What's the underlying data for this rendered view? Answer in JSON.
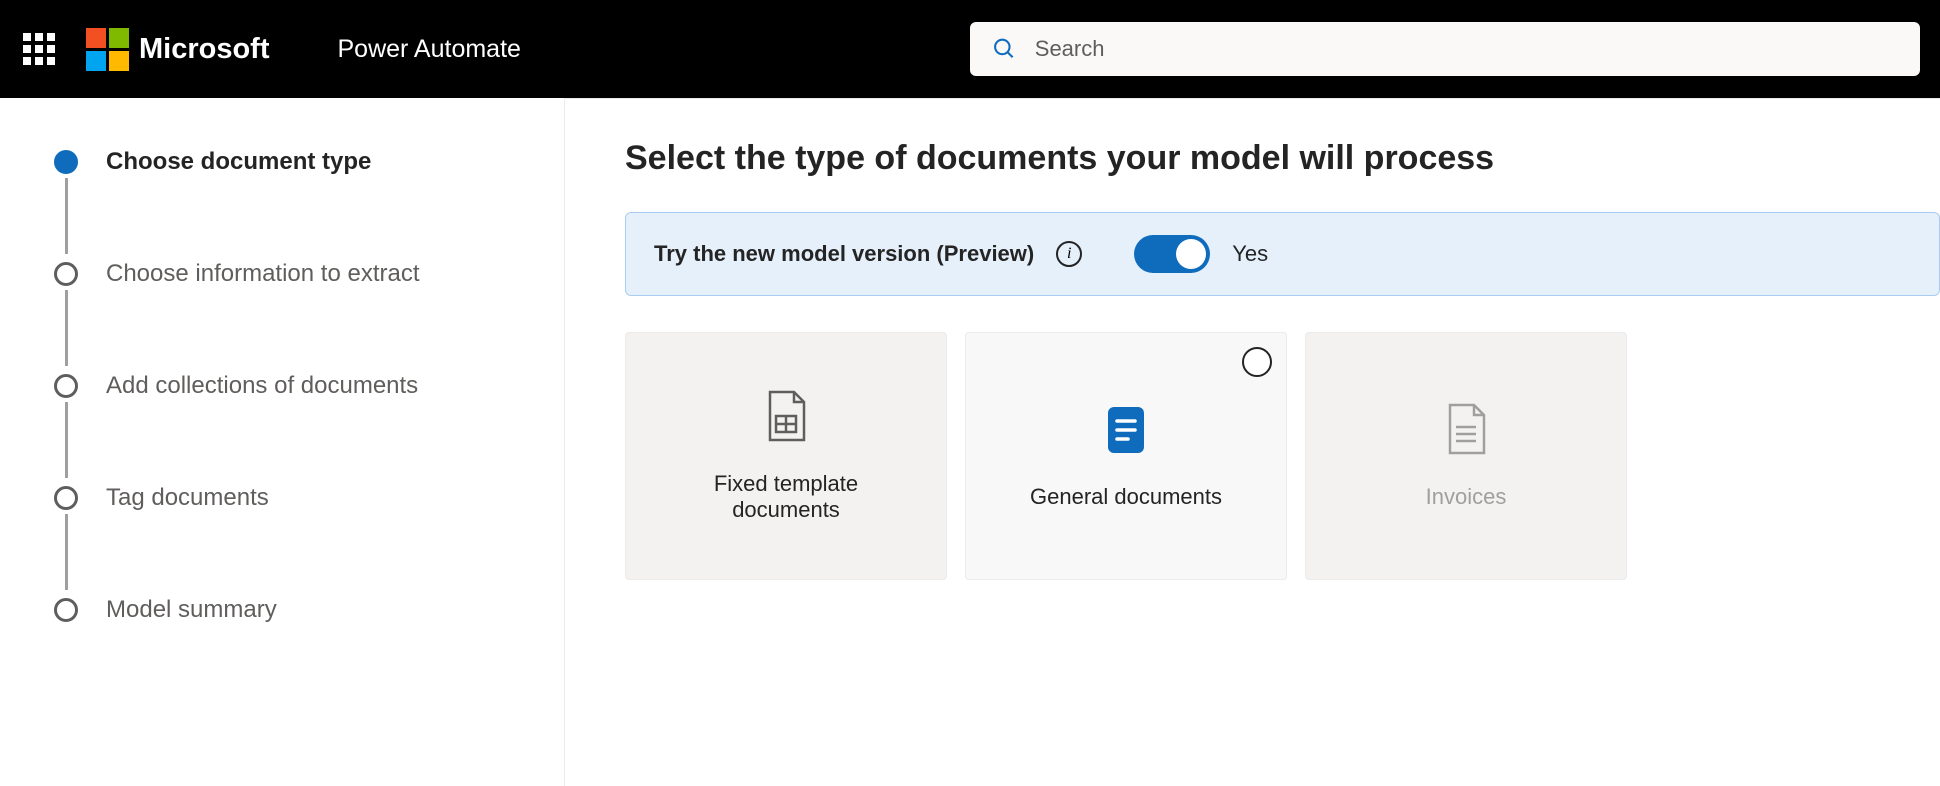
{
  "header": {
    "brand": "Microsoft",
    "app_name": "Power Automate",
    "search_placeholder": "Search"
  },
  "sidebar": {
    "steps": [
      {
        "label": "Choose document type",
        "active": true
      },
      {
        "label": "Choose information to extract",
        "active": false
      },
      {
        "label": "Add collections of documents",
        "active": false
      },
      {
        "label": "Tag documents",
        "active": false
      },
      {
        "label": "Model summary",
        "active": false
      }
    ]
  },
  "content": {
    "title": "Select the type of documents your model will process",
    "banner": {
      "text": "Try the new model version (Preview)",
      "toggle_state": "Yes"
    },
    "cards": [
      {
        "title": "Fixed template documents",
        "kind": "template",
        "show_radio": false,
        "muted": false
      },
      {
        "title": "General documents",
        "kind": "general",
        "show_radio": true,
        "muted": false
      },
      {
        "title": "Invoices",
        "kind": "invoice",
        "show_radio": false,
        "muted": true
      }
    ]
  }
}
